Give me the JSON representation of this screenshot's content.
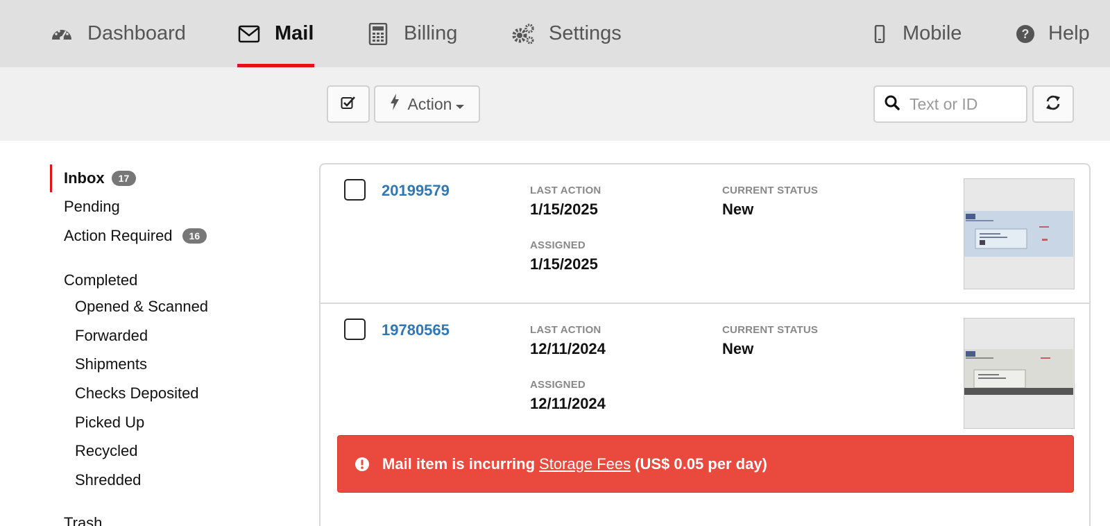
{
  "nav": {
    "dashboard": "Dashboard",
    "mail": "Mail",
    "billing": "Billing",
    "settings": "Settings",
    "mobile": "Mobile",
    "help": "Help"
  },
  "toolbar": {
    "action_label": "Action",
    "search_placeholder": "Text or ID"
  },
  "sidebar": {
    "inbox": {
      "label": "Inbox",
      "count": "17"
    },
    "pending": "Pending",
    "action_required": {
      "label": "Action Required",
      "count": "16"
    },
    "completed": "Completed",
    "sub": [
      "Opened & Scanned",
      "Forwarded",
      "Shipments",
      "Checks Deposited",
      "Picked Up",
      "Recycled",
      "Shredded"
    ],
    "trash": "Trash"
  },
  "labels": {
    "last_action": "LAST ACTION",
    "assigned": "ASSIGNED",
    "current_status": "CURRENT STATUS"
  },
  "items": [
    {
      "id": "20199579",
      "last_action": "1/15/2025",
      "assigned": "1/15/2025",
      "status": "New"
    },
    {
      "id": "19780565",
      "last_action": "12/11/2024",
      "assigned": "12/11/2024",
      "status": "New"
    }
  ],
  "alert": {
    "prefix": "Mail item is incurring",
    "link": "Storage Fees",
    "suffix": "(US$ 0.05 per day)"
  },
  "colors": {
    "accent": "#e2121b",
    "link": "#2f77b5",
    "alert": "#ea4a3e"
  }
}
